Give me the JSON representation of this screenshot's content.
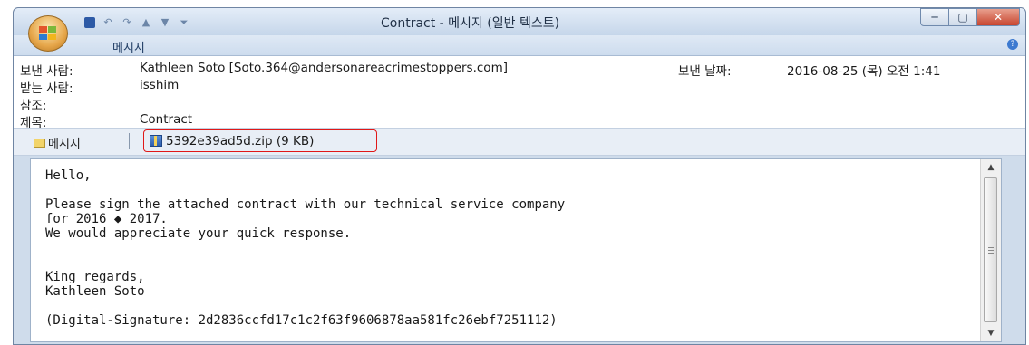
{
  "window": {
    "title": "Contract - 메시지 (일반 텍스트)",
    "minimize": "─",
    "maximize": "▢",
    "close": "✕"
  },
  "ribbon": {
    "tab": "메시지",
    "help": "?"
  },
  "header": {
    "from_label": "보낸 사람:",
    "from_value": "Kathleen Soto [Soto.364@andersonareacrimestoppers.com]",
    "sent_label": "보낸 날짜:",
    "sent_value": "2016-08-25 (목) 오전 1:41",
    "to_label": "받는 사람:",
    "to_value": "isshim",
    "cc_label": "참조:",
    "cc_value": "",
    "subject_label": "제목:",
    "subject_value": "Contract"
  },
  "attachments": {
    "message_tab": "메시지",
    "file": "5392e39ad5d.zip (9 KB)"
  },
  "body": {
    "text": "Hello,\n\nPlease sign the attached contract with our technical service company\nfor 2016 ◆ 2017.\nWe would appreciate your quick response.\n\n\nKing regards,\nKathleen Soto\n\n(Digital-Signature: 2d2836ccfd17c1c2f63f9606878aa581fc26ebf7251112)"
  }
}
